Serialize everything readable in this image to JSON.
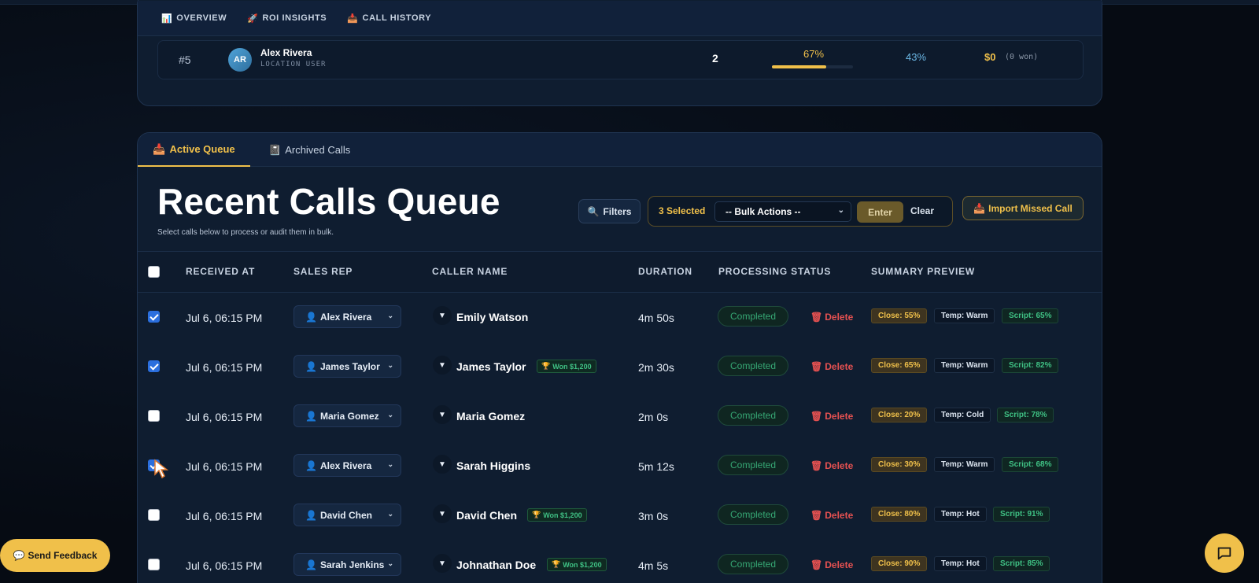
{
  "top_tabs": [
    {
      "icon": "📊",
      "label": "OVERVIEW"
    },
    {
      "icon": "🚀",
      "label": "ROI INSIGHTS"
    },
    {
      "icon": "📥",
      "label": "CALL HISTORY"
    }
  ],
  "leaderboard_row": {
    "rank": "#5",
    "initials": "AR",
    "name": "Alex Rivera",
    "role": "LOCATION USER",
    "calls": "2",
    "close_pct": "67%",
    "close_fraction": 0.67,
    "rate": "43%",
    "revenue": "$0",
    "won": "(0 won)"
  },
  "main_tabs": [
    {
      "icon": "📥",
      "label": "Active Queue"
    },
    {
      "icon": "📓",
      "label": "Archived Calls"
    }
  ],
  "header": {
    "title": "Recent Calls Queue",
    "subtitle": "Select calls below to process or audit them in bulk."
  },
  "toolbar": {
    "filters_icon": "🔍",
    "filters_label": "Filters",
    "selected_count": "3 Selected",
    "bulk_actions": "-- Bulk Actions --",
    "enter_label": "Enter",
    "clear_label": "Clear",
    "import_icon": "📥",
    "import_label": "Import Missed Call"
  },
  "table": {
    "columns": [
      "RECEIVED AT",
      "SALES REP",
      "CALLER NAME",
      "DURATION",
      "PROCESSING STATUS",
      "SUMMARY PREVIEW"
    ],
    "rows": [
      {
        "checked": true,
        "received": "Jul 6, 06:15 PM",
        "rep": "Alex Rivera",
        "caller": "Emily Watson",
        "won": "",
        "duration": "4m 50s",
        "status": "Completed",
        "delete": "Delete",
        "close": "Close: 55%",
        "temp": "Temp: Warm",
        "script": "Script: 65%"
      },
      {
        "checked": true,
        "received": "Jul 6, 06:15 PM",
        "rep": "James Taylor",
        "caller": "James Taylor",
        "won": "Won $1,200",
        "duration": "2m 30s",
        "status": "Completed",
        "delete": "Delete",
        "close": "Close: 65%",
        "temp": "Temp: Warm",
        "script": "Script: 82%"
      },
      {
        "checked": false,
        "received": "Jul 6, 06:15 PM",
        "rep": "Maria Gomez",
        "caller": "Maria Gomez",
        "won": "",
        "duration": "2m 0s",
        "status": "Completed",
        "delete": "Delete",
        "close": "Close: 20%",
        "temp": "Temp: Cold",
        "script": "Script: 78%"
      },
      {
        "checked": true,
        "received": "Jul 6, 06:15 PM",
        "rep": "Alex Rivera",
        "caller": "Sarah Higgins",
        "won": "",
        "duration": "5m 12s",
        "status": "Completed",
        "delete": "Delete",
        "close": "Close: 30%",
        "temp": "Temp: Warm",
        "script": "Script: 68%"
      },
      {
        "checked": false,
        "received": "Jul 6, 06:15 PM",
        "rep": "David Chen",
        "caller": "David Chen",
        "won": "Won $1,200",
        "duration": "3m 0s",
        "status": "Completed",
        "delete": "Delete",
        "close": "Close: 80%",
        "temp": "Temp: Hot",
        "script": "Script: 91%"
      },
      {
        "checked": false,
        "received": "Jul 6, 06:15 PM",
        "rep": "Sarah Jenkins",
        "caller": "Johnathan Doe",
        "won": "Won $1,200",
        "duration": "4m 5s",
        "status": "Completed",
        "delete": "Delete",
        "close": "Close: 90%",
        "temp": "Temp: Hot",
        "script": "Script: 85%"
      }
    ]
  },
  "feedback": {
    "icon": "💬",
    "label": "Send Feedback"
  },
  "colors": {
    "accent": "#f0c04a",
    "success": "#3fc184",
    "danger": "#e65151",
    "info": "#6cb8e6"
  }
}
